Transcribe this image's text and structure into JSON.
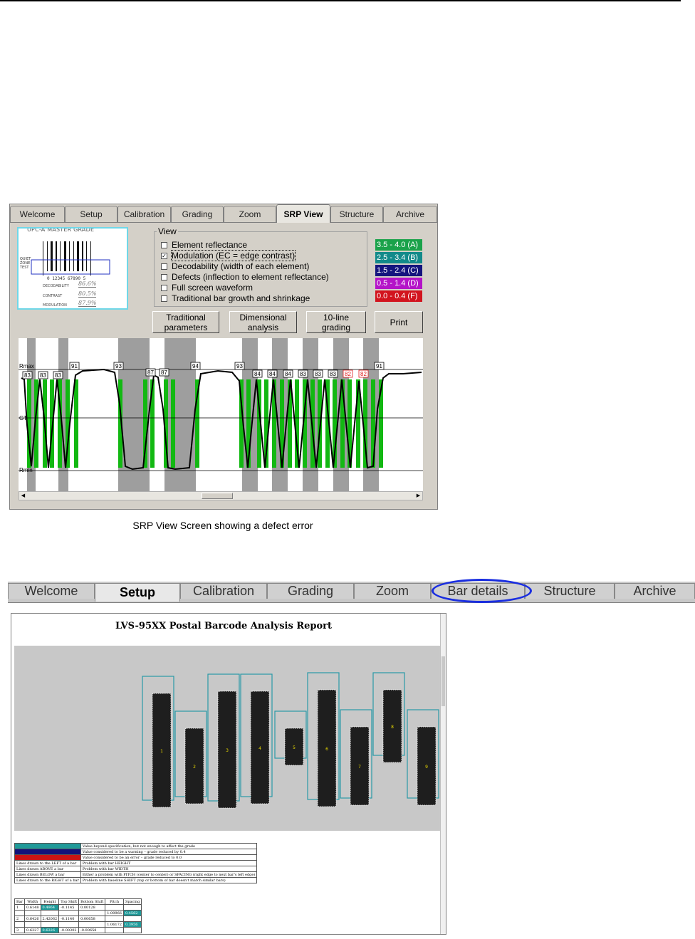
{
  "srp": {
    "tabs": [
      "Welcome",
      "Setup",
      "Calibration",
      "Grading",
      "Zoom",
      "SRP View",
      "Structure",
      "Archive"
    ],
    "active_tab": "SRP View",
    "thumbnail": {
      "title": "UPC-A MASTER GRADE",
      "side_labels": [
        "QUIET",
        "ZONE",
        "TEST"
      ],
      "digits": "0 12345 67890 5",
      "rows": [
        {
          "label": "DECODABILITY",
          "value": "86.6%"
        },
        {
          "label": "CONTRAST",
          "value": "80.5%"
        },
        {
          "label": "MODULATION",
          "value": "87.9%"
        }
      ]
    },
    "view": {
      "title": "View",
      "options": [
        {
          "label": "Element reflectance",
          "checked": false
        },
        {
          "label": "Modulation (EC = edge contrast)",
          "checked": true
        },
        {
          "label": "Decodability (width of each element)",
          "checked": false
        },
        {
          "label": "Defects (inflection to element reflectance)",
          "checked": false
        },
        {
          "label": "Full screen waveform",
          "checked": false
        },
        {
          "label": "Traditional bar growth and shrinkage",
          "checked": false
        }
      ]
    },
    "grades": [
      {
        "label": "3.5 - 4.0 (A)",
        "color": "#1aa24a"
      },
      {
        "label": "2.5 - 3.4 (B)",
        "color": "#128a8a"
      },
      {
        "label": "1.5 - 2.4 (C)",
        "color": "#14147e"
      },
      {
        "label": "0.5 - 1.4 (D)",
        "color": "#b414c8"
      },
      {
        "label": "0.0 - 0.4 (F)",
        "color": "#d2141e"
      }
    ],
    "buttons": {
      "traditional": [
        "Traditional",
        "parameters"
      ],
      "dimensional": [
        "Dimensional",
        "analysis"
      ],
      "tenline": [
        "10-line",
        "grading"
      ],
      "print": "Print"
    },
    "plot": {
      "rmax_label": "Rmax",
      "gt_label": "GT",
      "rmin_label": "Rmin",
      "modulation_labels": [
        {
          "value": "83",
          "defect": false
        },
        {
          "value": "83",
          "defect": false
        },
        {
          "value": "83",
          "defect": false
        },
        {
          "value": "91",
          "defect": false
        },
        {
          "value": "93",
          "defect": false
        },
        {
          "value": "87",
          "defect": false
        },
        {
          "value": "87",
          "defect": false
        },
        {
          "value": "94",
          "defect": false
        },
        {
          "value": "93",
          "defect": false
        },
        {
          "value": "84",
          "defect": false
        },
        {
          "value": "84",
          "defect": false
        },
        {
          "value": "84",
          "defect": false
        },
        {
          "value": "83",
          "defect": false
        },
        {
          "value": "83",
          "defect": false
        },
        {
          "value": "83",
          "defect": false
        },
        {
          "value": "82",
          "defect": true
        },
        {
          "value": "82",
          "defect": true
        },
        {
          "value": "91",
          "defect": false
        }
      ],
      "colors": {
        "bar": "#9e9e9e",
        "edge": "#12b812",
        "defect": "#e01c1c"
      }
    },
    "caption": "SRP View Screen showing a defect error"
  },
  "setup_bar": {
    "tabs": [
      "Welcome",
      "Setup",
      "Calibration",
      "Grading",
      "Zoom",
      "Bar details",
      "Structure",
      "Archive"
    ],
    "active_tab": "Setup",
    "highlighted_tab": "Bar details",
    "highlight_color": "#1a2ee0"
  },
  "report": {
    "title": "LVS-95XX Postal Barcode Analysis Report",
    "bar_numbers": [
      "1",
      "2",
      "3",
      "4",
      "5",
      "6",
      "7",
      "8",
      "9"
    ],
    "legend": [
      {
        "swatch": "#1f9a99",
        "text": "Value beyond specification, but not enough to affect the grade"
      },
      {
        "swatch": "#12127a",
        "text": "Value considered to be a warning – grade reduced by 0.4"
      },
      {
        "swatch": "#c81414",
        "text": "Value considered to be an error – grade reduced to 0.0"
      },
      {
        "label": "Lines drawn to the LEFT of a bar",
        "text": "Problem with bar HEIGHT"
      },
      {
        "label": "Lines drawn ABOVE a bar",
        "text": "Problem with bar WIDTH"
      },
      {
        "label": "Lines drawn BELOW a bar",
        "text": "Either a problem with PITCH (center to center) or SPACING (right edge to next bar's left edge)"
      },
      {
        "label": "Lines drawn to the RIGHT of a bar",
        "text": "Problem with baseline SHIFT (top or bottom of bar doesn't match similar bars)"
      }
    ],
    "table": {
      "headers": [
        "Bar",
        "Width",
        "Height",
        "Top Shift",
        "Bottom Shift",
        "Pitch",
        "Spacing"
      ],
      "rows": [
        [
          "1",
          "0.6148",
          "0.4964",
          "-0.1145",
          "0.00128",
          "",
          ""
        ],
        [
          "",
          "",
          "",
          "",
          "",
          "1.00966",
          "0.4562"
        ],
        [
          "2",
          "0.6426",
          "2.42062",
          "-0.1140",
          "0.00658",
          "",
          ""
        ],
        [
          "",
          "",
          "",
          "",
          "",
          "1.06172",
          "0.3956"
        ],
        [
          "3",
          "0.6327",
          "0.6326",
          "-0.00302",
          "-0.00658",
          "",
          ""
        ]
      ],
      "highlight_cells": [
        [
          0,
          2
        ],
        [
          1,
          6
        ],
        [
          3,
          6
        ],
        [
          4,
          2
        ]
      ]
    }
  }
}
